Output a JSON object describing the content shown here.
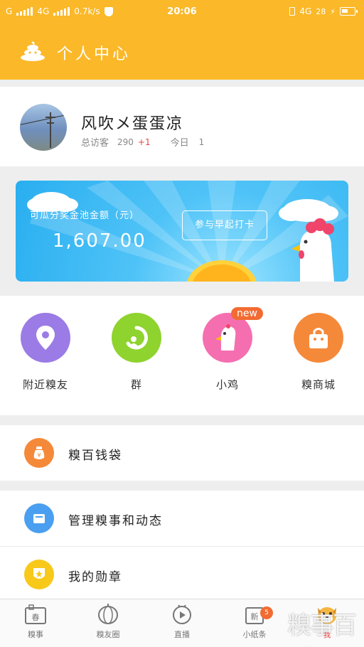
{
  "status_bar": {
    "network_left": "G",
    "network_mid": "4G",
    "speed": "0.7k/s",
    "time": "20:06",
    "network_right": "4G",
    "battery_level": "28",
    "icons": [
      "signal-icon",
      "shield-icon",
      "battery-icon",
      "charging-icon",
      "sim-icon"
    ]
  },
  "header": {
    "title": "个人中心",
    "logo_icon": "poop-logo-icon",
    "accent_color": "#fbb828"
  },
  "profile": {
    "nickname": "风吹メ蛋蛋凉",
    "visitors_label": "总访客",
    "visitors_count": "290",
    "visitors_delta": "+1",
    "today_label": "今日",
    "today_count": "1"
  },
  "banner": {
    "pool_label": "可瓜分奖金池金额（元）",
    "pool_amount": "1,607.00",
    "join_button": "参与早起打卡",
    "background_color": "#29aef0"
  },
  "quick_links": [
    {
      "label": "附近糗友",
      "icon": "location-pin-icon",
      "color": "#9b7be5"
    },
    {
      "label": "群",
      "icon": "group-icon",
      "color": "#8ed32e"
    },
    {
      "label": "小鸡",
      "icon": "chick-icon",
      "color": "#f56fb0",
      "badge": "new"
    },
    {
      "label": "糗商城",
      "icon": "shopping-bag-icon",
      "color": "#f5893a"
    }
  ],
  "list_items": [
    {
      "label": "糗百钱袋",
      "icon": "money-bag-icon",
      "color": "#f5893a"
    },
    {
      "label": "管理糗事和动态",
      "icon": "inbox-icon",
      "color": "#4a9ff0"
    },
    {
      "label": "我的勋章",
      "icon": "badge-icon",
      "color": "#f8c81a"
    }
  ],
  "bottom_nav": [
    {
      "label": "糗事",
      "icon": "spring-couplet-icon"
    },
    {
      "label": "糗友圈",
      "icon": "lantern-icon"
    },
    {
      "label": "直播",
      "icon": "play-robot-icon"
    },
    {
      "label": "小纸条",
      "icon": "message-new-icon",
      "badge": "5"
    },
    {
      "label": "我",
      "icon": "dog-avatar-icon",
      "active": true
    }
  ],
  "watermark": "糗事百科"
}
